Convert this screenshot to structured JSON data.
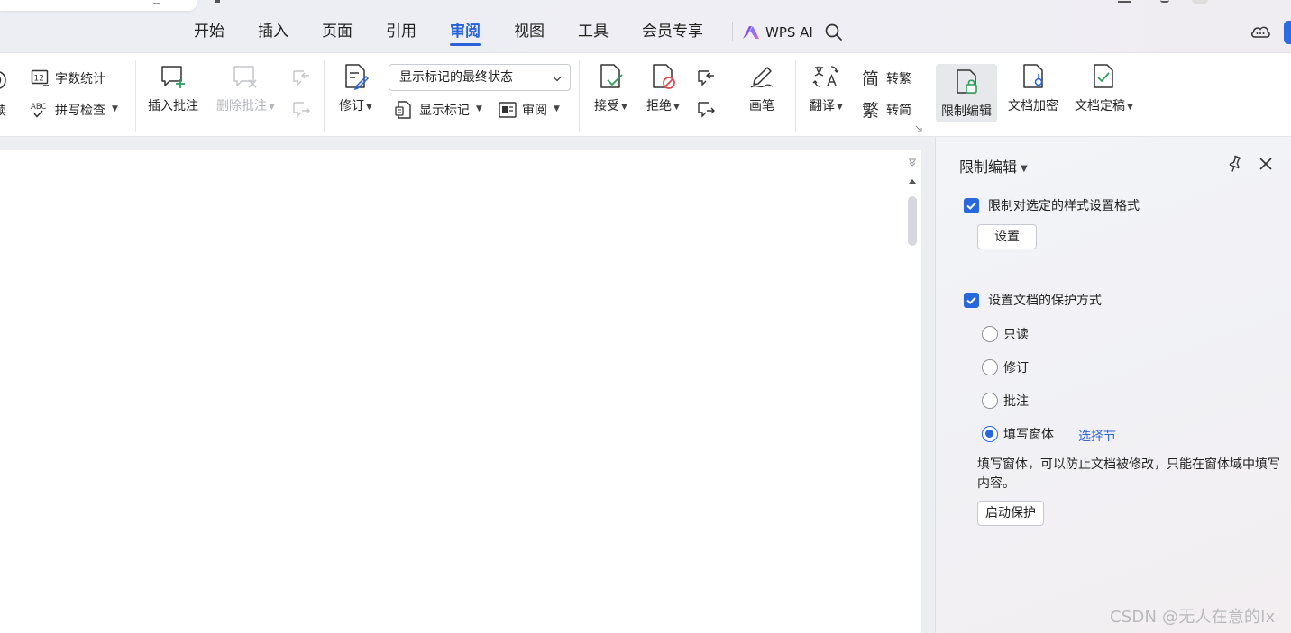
{
  "menu": {
    "tabs": [
      {
        "label": "开始"
      },
      {
        "label": "插入"
      },
      {
        "label": "页面"
      },
      {
        "label": "引用"
      },
      {
        "label": "审阅"
      },
      {
        "label": "视图"
      },
      {
        "label": "工具"
      },
      {
        "label": "会员专享"
      }
    ],
    "active_tab": "审阅",
    "wps_ai_label": "WPS AI"
  },
  "ribbon": {
    "read_label_fragment": "读",
    "word_count_label": "字数统计",
    "spell_check_label": "拼写检查",
    "spell_icon_text": "ABC",
    "wordcount_icon_text": "12",
    "insert_comment_label": "插入批注",
    "delete_comment_label": "删除批注",
    "track_changes_label": "修订",
    "view_mode_value": "显示标记的最终状态",
    "show_markup_label": "显示标记",
    "review_pane_label": "审阅",
    "accept_label": "接受",
    "reject_label": "拒绝",
    "pen_label": "画笔",
    "translate_label": "翻译",
    "to_traditional_label": "转繁",
    "to_simplified_label": "转简",
    "restrict_edit_label": "限制编辑",
    "encrypt_label": "文档加密",
    "finalize_label": "文档定稿"
  },
  "panel": {
    "title": "限制编辑",
    "format_restrict_label": "限制对选定的样式设置格式",
    "format_restrict_checked": true,
    "settings_button": "设置",
    "protection_label": "设置文档的保护方式",
    "protection_checked": true,
    "options": [
      {
        "label": "只读",
        "selected": false
      },
      {
        "label": "修订",
        "selected": false
      },
      {
        "label": "批注",
        "selected": false
      },
      {
        "label": "填写窗体",
        "selected": true
      }
    ],
    "select_section_link": "选择节",
    "description": "填写窗体，可以防止文档被修改，只能在窗体域中填写内容。",
    "start_protection_button": "启动保护"
  },
  "watermark": "CSDN @无人在意的lx",
  "colors": {
    "accent": "#2862d8",
    "checkbox": "#2868dd",
    "link": "#2d66d8"
  }
}
